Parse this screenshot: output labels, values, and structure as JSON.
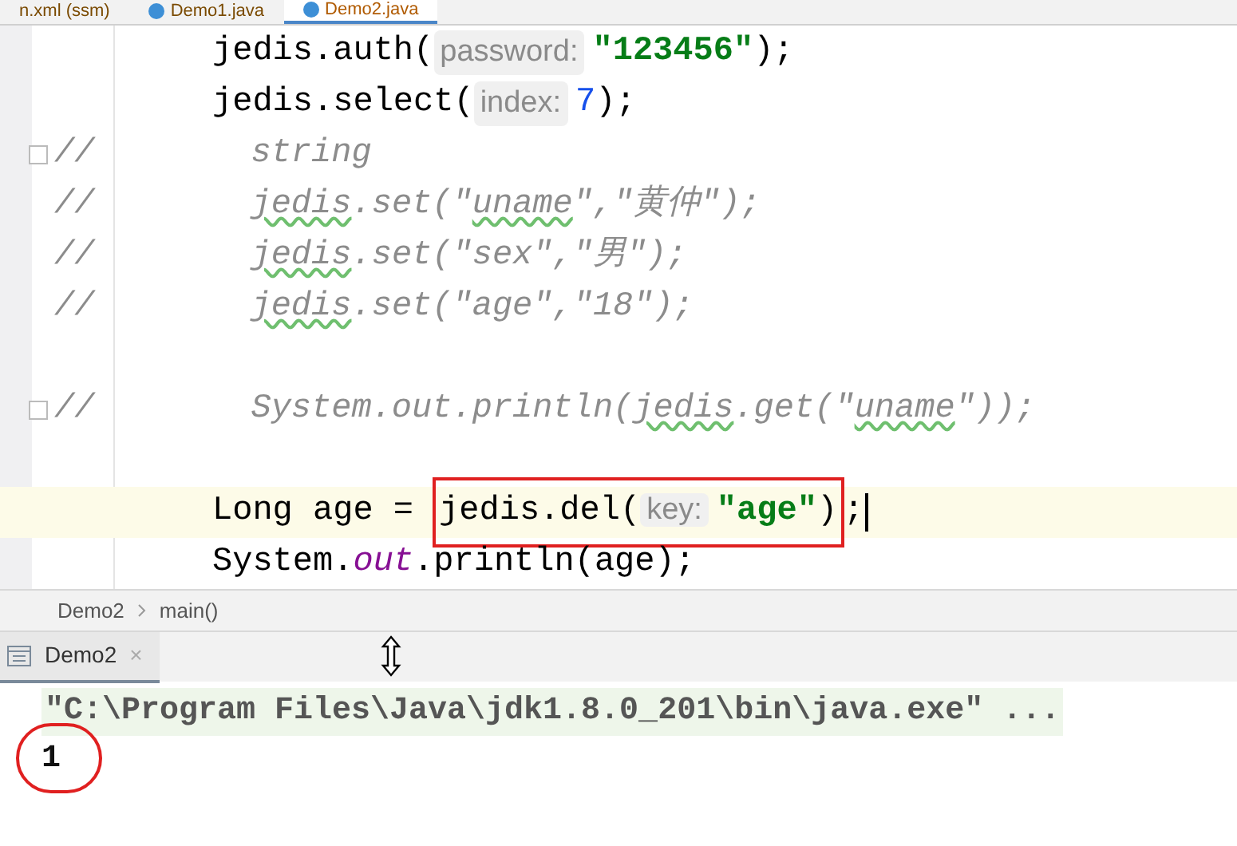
{
  "editor_tabs": [
    {
      "label": "n.xml (ssm)",
      "kind": "xml",
      "selected": false
    },
    {
      "label": "Demo1.java",
      "kind": "java",
      "selected": false
    },
    {
      "label": "Demo2.java",
      "kind": "java",
      "selected": true
    }
  ],
  "code_lines": [
    {
      "kind": "code",
      "current": false,
      "segments": [
        {
          "text": "jedis.auth(",
          "kind": "plain"
        },
        {
          "text": "password:",
          "kind": "hint"
        },
        {
          "text": "\"123456\"",
          "kind": "string"
        },
        {
          "text": ");",
          "kind": "plain"
        }
      ]
    },
    {
      "kind": "code",
      "current": false,
      "segments": [
        {
          "text": "jedis.select(",
          "kind": "plain"
        },
        {
          "text": "index:",
          "kind": "hint"
        },
        {
          "text": "7",
          "kind": "number"
        },
        {
          "text": ");",
          "kind": "plain"
        }
      ]
    },
    {
      "kind": "commented",
      "fold": true,
      "current": false,
      "segments": [
        {
          "text": "string",
          "kind": "comment"
        }
      ]
    },
    {
      "kind": "commented",
      "fold": false,
      "current": false,
      "segments": [
        {
          "text": "jedis",
          "kind": "comment_warn"
        },
        {
          "text": ".set(\"",
          "kind": "comment"
        },
        {
          "text": "uname",
          "kind": "comment_warn"
        },
        {
          "text": "\",\"黄仲\");",
          "kind": "comment"
        }
      ]
    },
    {
      "kind": "commented",
      "fold": false,
      "current": false,
      "segments": [
        {
          "text": "jedis",
          "kind": "comment_warn"
        },
        {
          "text": ".set(\"sex\",\"男\");",
          "kind": "comment"
        }
      ]
    },
    {
      "kind": "commented",
      "fold": false,
      "current": false,
      "segments": [
        {
          "text": "jedis",
          "kind": "comment_warn"
        },
        {
          "text": ".set(\"age\",\"18\");",
          "kind": "comment"
        }
      ]
    },
    {
      "kind": "blank",
      "current": false
    },
    {
      "kind": "commented",
      "fold": true,
      "current": false,
      "segments": [
        {
          "text": "System.out.println(",
          "kind": "comment"
        },
        {
          "text": "jedis",
          "kind": "comment_warn"
        },
        {
          "text": ".get(\"",
          "kind": "comment"
        },
        {
          "text": "uname",
          "kind": "comment_warn"
        },
        {
          "text": "\"));",
          "kind": "comment"
        }
      ]
    },
    {
      "kind": "blank",
      "current": false
    },
    {
      "kind": "code",
      "current": true,
      "segments": [
        {
          "text": "Long age =",
          "kind": "plain"
        },
        {
          "kind": "annotation_box",
          "segments": [
            {
              "text": "jedis.del(",
              "kind": "plain"
            },
            {
              "text": "key:",
              "kind": "hint"
            },
            {
              "text": "\"age\"",
              "kind": "string"
            },
            {
              "text": ")",
              "kind": "plain"
            }
          ]
        },
        {
          "text": ";",
          "kind": "plain"
        }
      ]
    },
    {
      "kind": "code",
      "current": false,
      "segments": [
        {
          "text": "System.",
          "kind": "plain"
        },
        {
          "text": "out",
          "kind": "field"
        },
        {
          "text": ".println(age);",
          "kind": "plain"
        }
      ]
    }
  ],
  "comment_marker": "//",
  "breadcrumb": [
    "Demo2",
    "main()"
  ],
  "run_tab": {
    "label": "Demo2",
    "selected": true,
    "close": "×"
  },
  "console_lines": [
    {
      "text": "\"C:\\Program Files\\Java\\jdk1.8.0_201\\bin\\java.exe\" ...",
      "kind": "command",
      "circled": false
    },
    {
      "text": "1",
      "kind": "output",
      "circled": true
    }
  ]
}
